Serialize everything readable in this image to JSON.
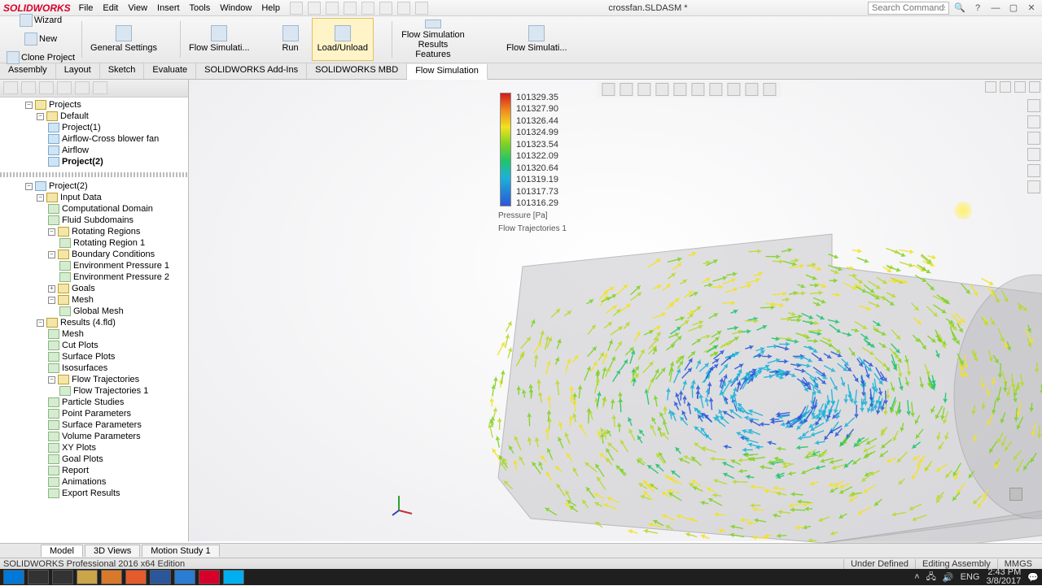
{
  "app": {
    "logo": "SOLIDWORKS",
    "doc_title": "crossfan.SLDASM *"
  },
  "menu": [
    "File",
    "Edit",
    "View",
    "Insert",
    "Tools",
    "Window",
    "Help"
  ],
  "search": {
    "placeholder": "Search Commands"
  },
  "ribbon": {
    "wizard": "Wizard",
    "new": "New",
    "clone": "Clone Project",
    "general": "General Settings",
    "flow": "Flow Simulati...",
    "run": "Run",
    "load": "Load/Unload",
    "flowsim": "Flow Simulation Results Features",
    "flowsim2": "Flow Simulati..."
  },
  "tabs": [
    "Assembly",
    "Layout",
    "Sketch",
    "Evaluate",
    "SOLIDWORKS Add-Ins",
    "SOLIDWORKS MBD",
    "Flow Simulation"
  ],
  "tree_top": {
    "root": "Projects",
    "default": "Default",
    "items": [
      "Project(1)",
      "Airflow-Cross blower fan",
      "Airflow",
      "Project(2)"
    ]
  },
  "tree_bottom": {
    "root": "Project(2)",
    "input": "Input Data",
    "cd": "Computational Domain",
    "fs": "Fluid Subdomains",
    "rr": "Rotating Regions",
    "rr1": "Rotating Region 1",
    "bc": "Boundary Conditions",
    "ep1": "Environment Pressure 1",
    "ep2": "Environment Pressure 2",
    "goals": "Goals",
    "mesh": "Mesh",
    "gm": "Global Mesh",
    "results": "Results (4.fld)",
    "rmesh": "Mesh",
    "cut": "Cut Plots",
    "surf": "Surface Plots",
    "iso": "Isosurfaces",
    "ft": "Flow Trajectories",
    "ft1": "Flow Trajectories 1",
    "ps": "Particle Studies",
    "pp": "Point Parameters",
    "sp": "Surface Parameters",
    "vp": "Volume Parameters",
    "xy": "XY Plots",
    "gp": "Goal Plots",
    "rep": "Report",
    "anim": "Animations",
    "exp": "Export Results"
  },
  "legend": {
    "values": [
      "101329.35",
      "101327.90",
      "101326.44",
      "101324.99",
      "101323.54",
      "101322.09",
      "101320.64",
      "101319.19",
      "101317.73",
      "101316.29"
    ],
    "caption": "Pressure [Pa]",
    "caption2": "Flow Trajectories 1"
  },
  "bottom_tabs": [
    "Model",
    "3D Views",
    "Motion Study 1"
  ],
  "status": {
    "left": "SOLIDWORKS Professional 2016 x64 Edition",
    "under": "Under Defined",
    "editing": "Editing Assembly",
    "units": "MMGS"
  },
  "tray": {
    "lang": "ENG",
    "time": "2:43 PM",
    "date": "3/8/2017"
  }
}
